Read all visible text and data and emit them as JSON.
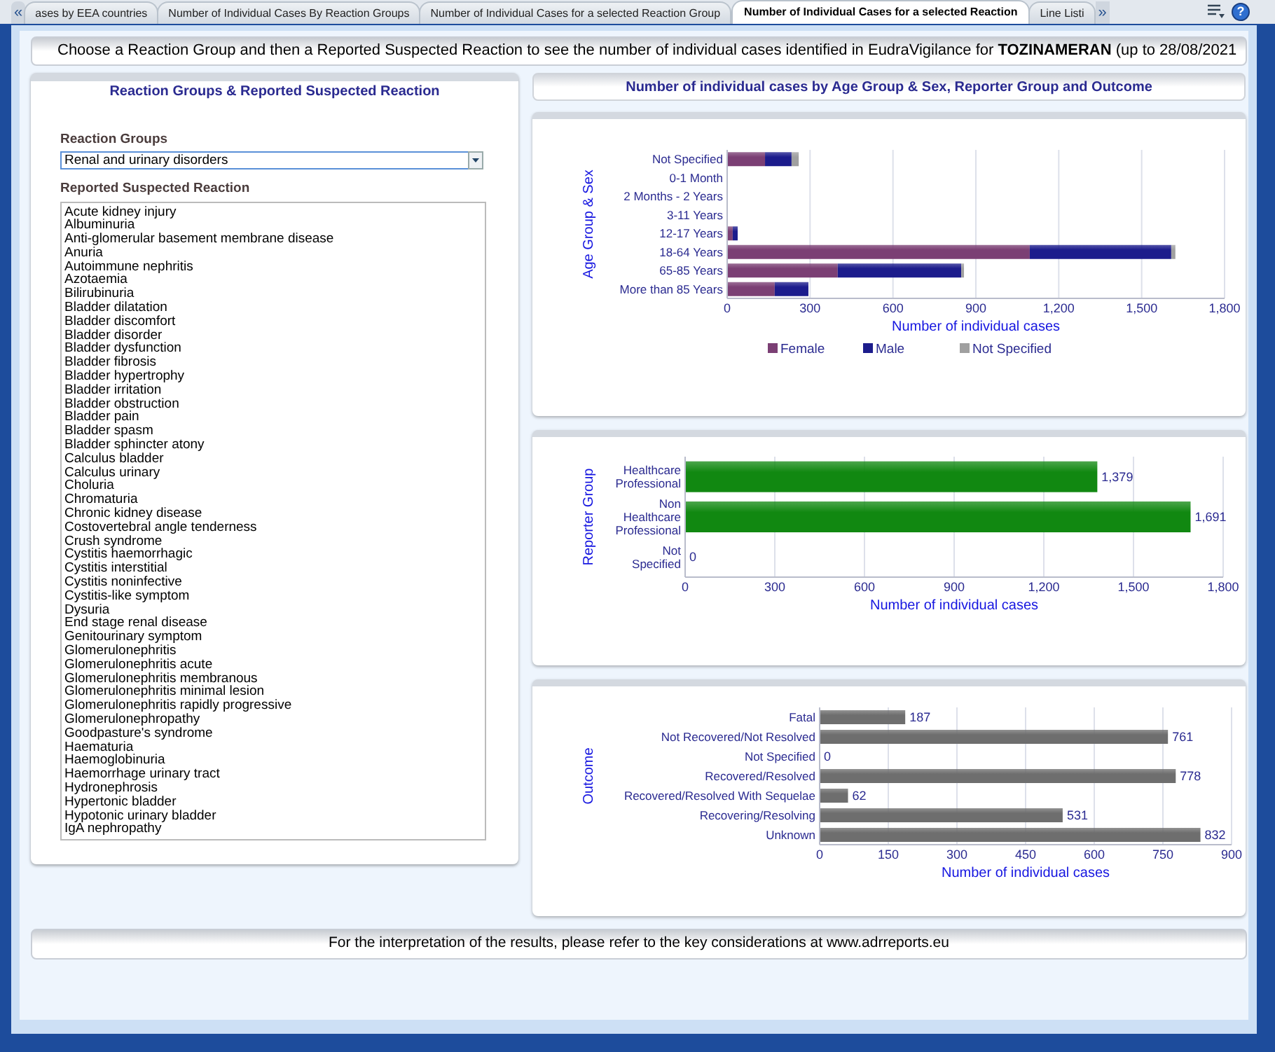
{
  "tabs": {
    "prev": "«",
    "next": "»",
    "items": [
      {
        "label": "ases by EEA countries",
        "selected": false
      },
      {
        "label": "Number of Individual Cases By Reaction Groups",
        "selected": false
      },
      {
        "label": "Number of Individual Cases for a selected Reaction Group",
        "selected": false
      },
      {
        "label": "Number of Individual Cases for a selected Reaction",
        "selected": true
      },
      {
        "label": "Line Listi",
        "selected": false
      }
    ],
    "help": "?"
  },
  "title": "Choose a Reaction Group and then a Reported Suspected Reaction to see the number of individual cases identified in EudraVigilance for **TOZINAMERAN** (up to 28/08/2021",
  "left_panel": {
    "title": "Reaction Groups & Reported Suspected Reaction",
    "group_label": "Reaction Groups",
    "group_value": "Renal and urinary disorders",
    "reaction_label": "Reported Suspected Reaction",
    "reactions": [
      "Acute kidney injury",
      "Albuminuria",
      "Anti-glomerular basement membrane disease",
      "Anuria",
      "Autoimmune nephritis",
      "Azotaemia",
      "Bilirubinuria",
      "Bladder dilatation",
      "Bladder discomfort",
      "Bladder disorder",
      "Bladder dysfunction",
      "Bladder fibrosis",
      "Bladder hypertrophy",
      "Bladder irritation",
      "Bladder obstruction",
      "Bladder pain",
      "Bladder spasm",
      "Bladder sphincter atony",
      "Calculus bladder",
      "Calculus urinary",
      "Choluria",
      "Chromaturia",
      "Chronic kidney disease",
      "Costovertebral angle tenderness",
      "Crush syndrome",
      "Cystitis haemorrhagic",
      "Cystitis interstitial",
      "Cystitis noninfective",
      "Cystitis-like symptom",
      "Dysuria",
      "End stage renal disease",
      "Genitourinary symptom",
      "Glomerulonephritis",
      "Glomerulonephritis acute",
      "Glomerulonephritis membranous",
      "Glomerulonephritis minimal lesion",
      "Glomerulonephritis rapidly progressive",
      "Glomerulonephropathy",
      "Goodpasture's syndrome",
      "Haematuria",
      "Haemoglobinuria",
      "Haemorrhage urinary tract",
      "Hydronephrosis",
      "Hypertonic bladder",
      "Hypotonic urinary bladder",
      "IgA nephropathy"
    ]
  },
  "right_panel": {
    "title": "Number of individual cases by Age Group & Sex, Reporter Group and Outcome",
    "age_chart": {
      "chart_data": {
        "type": "bar",
        "orientation": "horizontal",
        "stacked": true,
        "xlabel": "Number of individual cases",
        "ylabel": "Age Group & Sex",
        "grid": true,
        "legend": true,
        "categories": [
          "Not Specified",
          "0-1 Month",
          "2 Months - 2 Years",
          "3-11 Years",
          "12-17 Years",
          "18-64 Years",
          "65-85 Years",
          "More than 85 Years"
        ],
        "series": [
          {
            "name": "Female",
            "color": "#7b3f74",
            "values": [
              137,
              0,
              0,
              0,
              20,
              1095,
              400,
              172
            ]
          },
          {
            "name": "Male",
            "color": "#1c1c8c",
            "values": [
              96,
              0,
              0,
              0,
              18,
              512,
              447,
              122
            ]
          },
          {
            "name": "Not Specified",
            "color": "#a0a0a0",
            "values": [
              26,
              0,
              0,
              0,
              0,
              15,
              10,
              0
            ]
          }
        ],
        "xlim": [
          0,
          1800
        ],
        "xticks": [
          {
            "value": 0,
            "label": "0"
          },
          {
            "value": 300,
            "label": "300"
          },
          {
            "value": 600,
            "label": "600"
          },
          {
            "value": 900,
            "label": "900"
          },
          {
            "value": 1200,
            "label": "1,200"
          },
          {
            "value": 1500,
            "label": "1,500"
          },
          {
            "value": 1800,
            "label": "1,800"
          }
        ]
      }
    },
    "reporter_chart": {
      "chart_data": {
        "type": "bar",
        "orientation": "horizontal",
        "xlabel": "Number of individual cases",
        "ylabel": "Reporter Group",
        "categories": [
          "Healthcare Professional",
          "Non Healthcare Professional",
          "Not Specified"
        ],
        "grid": true,
        "series": [
          {
            "color": "#118811",
            "values": [
              1379,
              1691,
              0
            ]
          }
        ],
        "value_labels": [
          "1,379",
          "1,691",
          "0"
        ],
        "xlim": [
          0,
          1800
        ],
        "xticks": [
          {
            "value": 0,
            "label": "0"
          },
          {
            "value": 300,
            "label": "300"
          },
          {
            "value": 600,
            "label": "600"
          },
          {
            "value": 900,
            "label": "900"
          },
          {
            "value": 1200,
            "label": "1,200"
          },
          {
            "value": 1500,
            "label": "1,500"
          },
          {
            "value": 1800,
            "label": "1,800"
          }
        ]
      }
    },
    "outcome_chart": {
      "chart_data": {
        "type": "bar",
        "orientation": "horizontal",
        "xlabel": "Number of individual cases",
        "ylabel": "Outcome",
        "categories": [
          "Fatal",
          "Not Recovered/Not Resolved",
          "Not Specified",
          "Recovered/Resolved",
          "Recovered/Resolved With Sequelae",
          "Recovering/Resolving",
          "Unknown"
        ],
        "grid": true,
        "series": [
          {
            "color": "#6e6e6e",
            "values": [
              187,
              761,
              0,
              778,
              62,
              531,
              832
            ]
          }
        ],
        "value_labels": [
          "187",
          "761",
          "0",
          "778",
          "62",
          "531",
          "832"
        ],
        "xlim": [
          0,
          900
        ],
        "xticks": [
          0,
          150,
          300,
          450,
          600,
          750,
          900
        ]
      }
    }
  },
  "footer": "For the interpretation of the results, please refer to the key considerations at www.adrreports.eu"
}
